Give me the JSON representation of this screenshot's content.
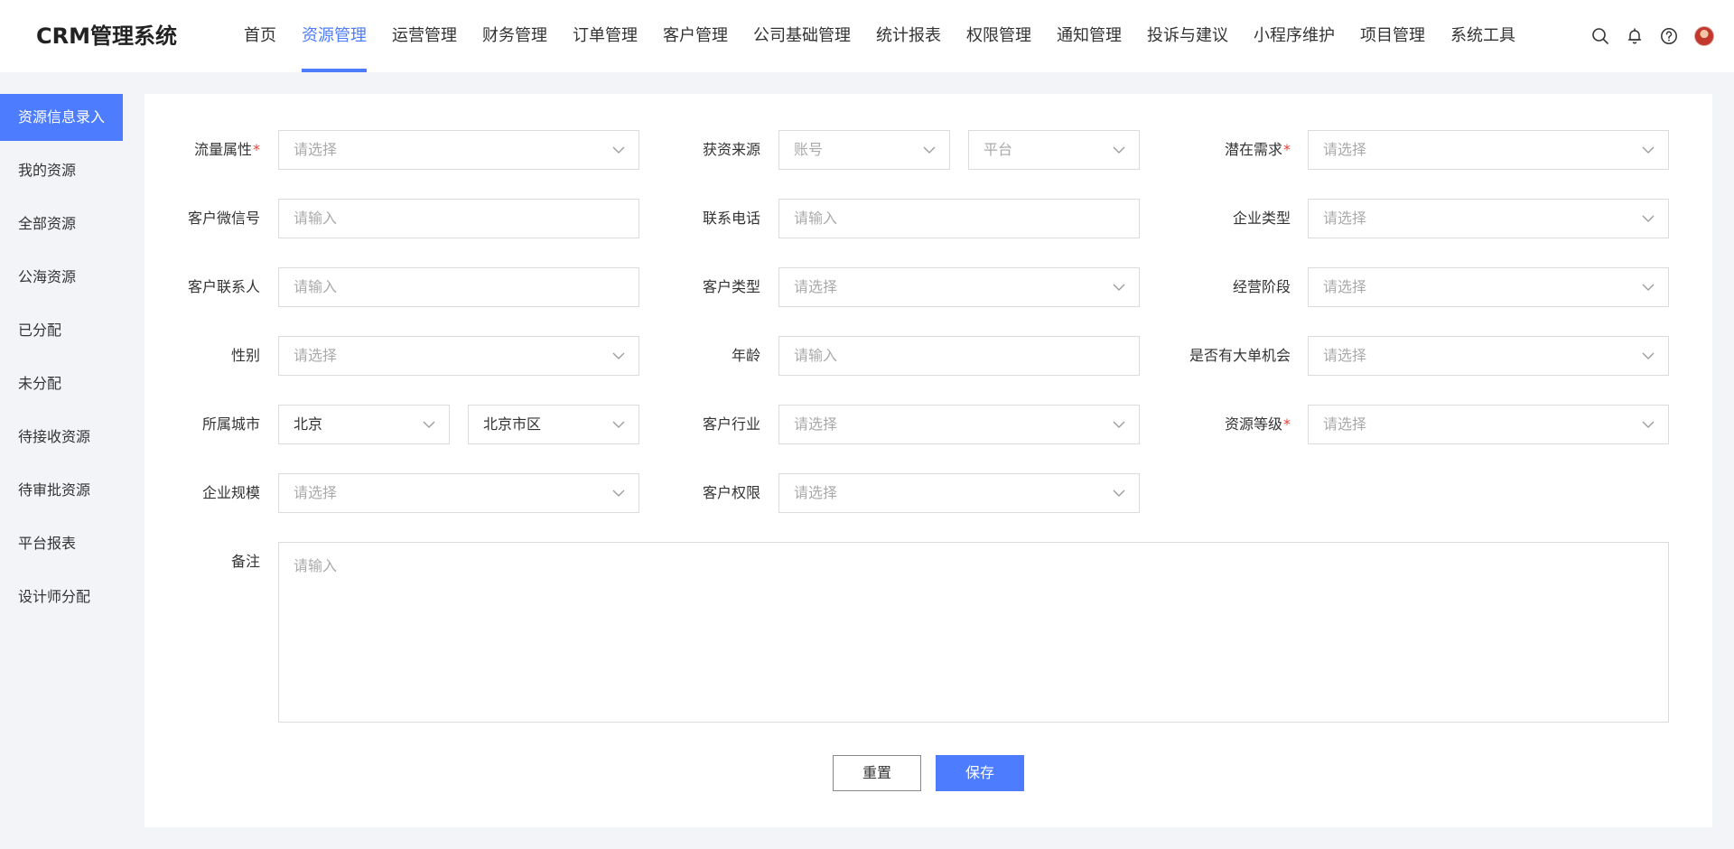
{
  "app": {
    "title": "CRM管理系统"
  },
  "nav": {
    "items": [
      {
        "label": "首页"
      },
      {
        "label": "资源管理"
      },
      {
        "label": "运营管理"
      },
      {
        "label": "财务管理"
      },
      {
        "label": "订单管理"
      },
      {
        "label": "客户管理"
      },
      {
        "label": "公司基础管理"
      },
      {
        "label": "统计报表"
      },
      {
        "label": "权限管理"
      },
      {
        "label": "通知管理"
      },
      {
        "label": "投诉与建议"
      },
      {
        "label": "小程序维护"
      },
      {
        "label": "项目管理"
      },
      {
        "label": "系统工具"
      }
    ],
    "active_index": 1
  },
  "header_icons": [
    "search-icon",
    "bell-icon",
    "help-icon",
    "avatar"
  ],
  "sidebar": {
    "items": [
      {
        "label": "资源信息录入"
      },
      {
        "label": "我的资源"
      },
      {
        "label": "全部资源"
      },
      {
        "label": "公海资源"
      },
      {
        "label": "已分配"
      },
      {
        "label": "未分配"
      },
      {
        "label": "待接收资源"
      },
      {
        "label": "待审批资源"
      },
      {
        "label": "平台报表"
      },
      {
        "label": "设计师分配"
      }
    ],
    "active_index": 0
  },
  "form": {
    "traffic_attr": {
      "label": "流量属性",
      "required_mark": "*",
      "placeholder": "请选择"
    },
    "source": {
      "label": "获资来源",
      "account_placeholder": "账号",
      "platform_placeholder": "平台"
    },
    "potential_need": {
      "label": "潜在需求",
      "required_mark": "*",
      "placeholder": "请选择"
    },
    "wechat": {
      "label": "客户微信号",
      "placeholder": "请输入"
    },
    "phone": {
      "label": "联系电话",
      "placeholder": "请输入"
    },
    "company_type": {
      "label": "企业类型",
      "placeholder": "请选择"
    },
    "contact": {
      "label": "客户联系人",
      "placeholder": "请输入"
    },
    "customer_type": {
      "label": "客户类型",
      "placeholder": "请选择"
    },
    "business_stage": {
      "label": "经营阶段",
      "placeholder": "请选择"
    },
    "gender": {
      "label": "性别",
      "placeholder": "请选择"
    },
    "age": {
      "label": "年龄",
      "placeholder": "请输入"
    },
    "big_deal": {
      "label": "是否有大单机会",
      "placeholder": "请选择"
    },
    "city": {
      "label": "所属城市",
      "province_value": "北京",
      "district_value": "北京市区"
    },
    "industry": {
      "label": "客户行业",
      "placeholder": "请选择"
    },
    "resource_level": {
      "label": "资源等级",
      "required_mark": "*",
      "placeholder": "请选择"
    },
    "company_scale": {
      "label": "企业规模",
      "placeholder": "请选择"
    },
    "customer_permission": {
      "label": "客户权限",
      "placeholder": "请选择"
    },
    "remark": {
      "label": "备注",
      "placeholder": "请输入"
    }
  },
  "buttons": {
    "reset": "重置",
    "save": "保存"
  },
  "colors": {
    "primary": "#4d7cfe",
    "required": "#e5413a",
    "background": "#f3f4f8"
  }
}
